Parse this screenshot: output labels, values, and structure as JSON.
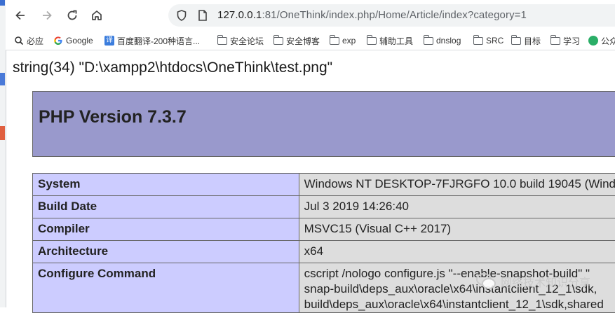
{
  "browser": {
    "url_host": "127.0.0.1",
    "url_rest": ":81/OneThink/index.php/Home/Article/index?category=1",
    "nav_icons": [
      "back-icon",
      "forward-icon",
      "reload-icon",
      "home-icon"
    ],
    "bookmarks": [
      {
        "label": "必应",
        "icon": "search-icon"
      },
      {
        "label": "Google",
        "icon": "google-icon"
      },
      {
        "label": "百度翻译-200种语言...",
        "icon": "translate-icon"
      },
      {
        "label": "安全论坛",
        "icon": "folder-icon"
      },
      {
        "label": "安全博客",
        "icon": "folder-icon"
      },
      {
        "label": "exp",
        "icon": "folder-icon"
      },
      {
        "label": "辅助工具",
        "icon": "folder-icon"
      },
      {
        "label": "dnslog",
        "icon": "folder-icon"
      },
      {
        "label": "SRC",
        "icon": "folder-icon"
      },
      {
        "label": "目标",
        "icon": "folder-icon"
      },
      {
        "label": "学习",
        "icon": "folder-icon"
      },
      {
        "label": "公众",
        "icon": "wechat-icon"
      }
    ]
  },
  "page": {
    "dump_line": "string(34) \"D:\\xampp2\\htdocs\\OneThink\\test.png\"",
    "php_title": "PHP Version 7.3.7",
    "rows": [
      {
        "key": "System",
        "value": [
          "Windows NT DESKTOP-7FJRGFO 10.0 build 19045 (Wind"
        ]
      },
      {
        "key": "Build Date",
        "value": [
          "Jul 3 2019 14:26:40"
        ]
      },
      {
        "key": "Compiler",
        "value": [
          "MSVC15 (Visual C++ 2017)"
        ]
      },
      {
        "key": "Architecture",
        "value": [
          "x64"
        ]
      },
      {
        "key": "Configure Command",
        "value": [
          "cscript /nologo configure.js \"--enable-snapshot-build\" \"",
          "snap-build\\deps_aux\\oracle\\x64\\instantclient_12_1\\sdk,",
          "build\\deps_aux\\oracle\\x64\\instantclient_12_1\\sdk,shared"
        ]
      }
    ],
    "watermark": "网络技术知识分享"
  },
  "colors": {
    "header_bg": "#9999cc",
    "key_bg": "#ccccff",
    "value_bg": "#dddddd"
  }
}
